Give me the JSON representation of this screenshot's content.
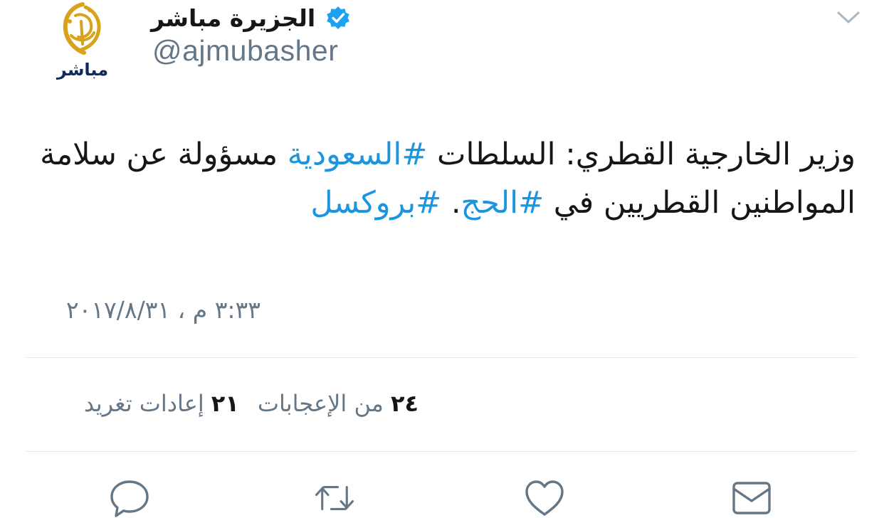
{
  "account": {
    "display_name": "الجزيرة مباشر",
    "handle": "@ajmubasher",
    "avatar_label": "مباشر",
    "verified": true
  },
  "tweet": {
    "text_part1": "وزير الخارجية القطري: السلطات ",
    "hashtag1": "#السعودية",
    "text_part2": " مسؤولة عن سلامة المواطنين القطريين في ",
    "hashtag2": "#الحج",
    "text_part3": ". ",
    "hashtag3": "#بروكسل",
    "timestamp": "٣:٣٣ م ، ٢٠١٧/٨/٣١"
  },
  "stats": {
    "retweets_count": "٢١",
    "retweets_label": "إعادات تغريد",
    "likes_count": "٢٤",
    "likes_label": "من الإعجابات"
  },
  "icons": {
    "menu": "chevron-down-icon",
    "reply": "reply-icon",
    "retweet": "retweet-icon",
    "like": "heart-icon",
    "message": "envelope-icon",
    "verified": "verified-badge-icon"
  },
  "colors": {
    "hashtag": "#1b95e0",
    "secondary_text": "#657786",
    "verified": "#1da1f2",
    "logo_gold": "#d9a21b",
    "divider": "#e1e8ed"
  }
}
